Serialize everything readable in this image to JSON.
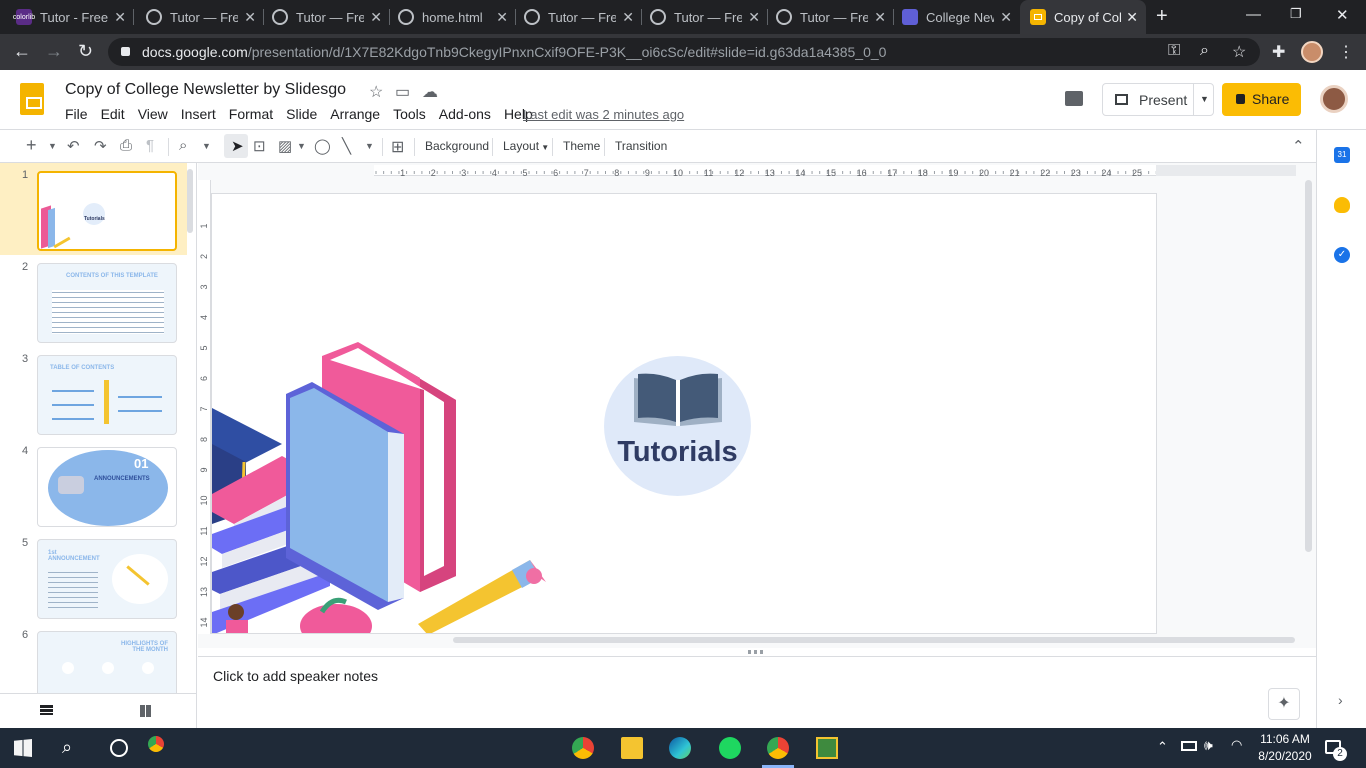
{
  "browser": {
    "tabs": [
      {
        "title": "Tutor - Free",
        "favicon": "colorlib-icon",
        "favicon_color": "#5a2c86"
      },
      {
        "title": "Tutor — Free",
        "favicon": "globe-icon"
      },
      {
        "title": "Tutor — Free",
        "favicon": "globe-icon"
      },
      {
        "title": "home.html",
        "favicon": "globe-icon"
      },
      {
        "title": "Tutor — Free",
        "favicon": "globe-icon"
      },
      {
        "title": "Tutor — Free",
        "favicon": "globe-icon"
      },
      {
        "title": "Tutor — Free",
        "favicon": "globe-icon"
      },
      {
        "title": "College News",
        "favicon": "newsletter-icon",
        "favicon_color": "#5f5fd6"
      },
      {
        "title": "Copy of College",
        "favicon": "slides-icon",
        "favicon_color": "#f4b400",
        "active": true
      }
    ],
    "new_tab": "+",
    "url_host": "docs.google.com",
    "url_path": "/presentation/d/1X7E82KdgoTnb9CkegyIPnxnCxif9OFE-P3K__oi6cSc/edit#slide=id.g63da1a4385_0_0"
  },
  "app": {
    "doc_title": "Copy of College Newsletter by Slidesgo",
    "menu": [
      "File",
      "Edit",
      "View",
      "Insert",
      "Format",
      "Slide",
      "Arrange",
      "Tools",
      "Add-ons",
      "Help"
    ],
    "last_edit": "Last edit was 2 minutes ago",
    "present_label": "Present",
    "share_label": "Share",
    "accent": "#fbbc04"
  },
  "toolbar": {
    "background": "Background",
    "layout": "Layout",
    "theme": "Theme",
    "transition": "Transition"
  },
  "ruler": {
    "h": [
      "1",
      "2",
      "3",
      "4",
      "5",
      "6",
      "7",
      "8",
      "9",
      "10",
      "11",
      "12",
      "13",
      "14",
      "15",
      "16",
      "17",
      "18",
      "19",
      "20",
      "21",
      "22",
      "23",
      "24",
      "25"
    ],
    "v": [
      "1",
      "2",
      "3",
      "4",
      "5",
      "6",
      "7",
      "8",
      "9",
      "10",
      "11",
      "12",
      "13",
      "14"
    ]
  },
  "slides": [
    {
      "num": "1",
      "title": "Tutorials"
    },
    {
      "num": "2",
      "title": "CONTENTS OF THIS TEMPLATE"
    },
    {
      "num": "3",
      "title": "TABLE OF CONTENTS"
    },
    {
      "num": "4",
      "title": "ANNOUNCEMENTS",
      "number": "01"
    },
    {
      "num": "5",
      "title": "1st ANNOUNCEMENT"
    },
    {
      "num": "6",
      "title": "HIGHLIGHTS OF THE MONTH"
    }
  ],
  "slide_main": {
    "badge_text": "Tutorials"
  },
  "notes": {
    "placeholder": "Click to add speaker notes"
  },
  "taskbar": {
    "time": "11:06 AM",
    "date": "8/20/2020",
    "notification_count": "2"
  }
}
